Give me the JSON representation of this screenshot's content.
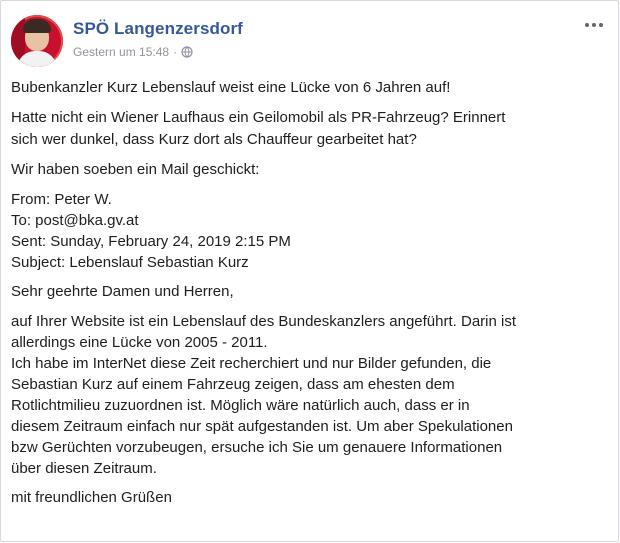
{
  "post": {
    "page_name": "SPÖ Langenzersdorf",
    "timestamp": "Gestern um 15:48",
    "separator": "·",
    "privacy_icon": "globe-icon",
    "more_icon": "more-options-icon",
    "lines": {
      "l1": "Bubenkanzler Kurz Lebenslauf weist eine Lücke von 6 Jahren auf!",
      "l2a": "Hatte nicht ein Wiener Laufhaus ein Geilomobil als PR-Fahrzeug? Erinnert",
      "l2b": "sich wer dunkel, dass Kurz dort als Chauffeur gearbeitet hat?",
      "l3": "Wir haben soeben ein Mail geschickt:",
      "from": "From: Peter W.",
      "to": "To: post@bka.gv.at",
      "sent": "Sent: Sunday, February 24, 2019 2:15 PM",
      "subject": "Subject: Lebenslauf Sebastian Kurz",
      "greeting": "Sehr geehrte Damen und Herren,",
      "p1a": "auf Ihrer Website ist ein Lebenslauf des Bundeskanzlers angeführt. Darin ist",
      "p1b": "allerdings eine Lücke von 2005 - 2011.",
      "p2a": "Ich habe im InterNet diese Zeit recherchiert und nur Bilder gefunden, die",
      "p2b": "Sebastian Kurz auf einem Fahrzeug zeigen, dass am ehesten dem",
      "p2c": "Rotlichtmilieu zuzuordnen ist. Möglich wäre natürlich auch, dass er in",
      "p2d": "diesem Zeitraum einfach nur spät aufgestanden ist. Um aber Spekulationen",
      "p2e": "bzw Gerüchten vorzubeugen, ersuche ich Sie um genauere Informationen",
      "p2f": "über diesen Zeitraum.",
      "closing": "mit freundlichen Grüßen"
    }
  },
  "colors": {
    "page_name": "#365899",
    "meta": "#90949c",
    "text": "#1c1e21"
  }
}
